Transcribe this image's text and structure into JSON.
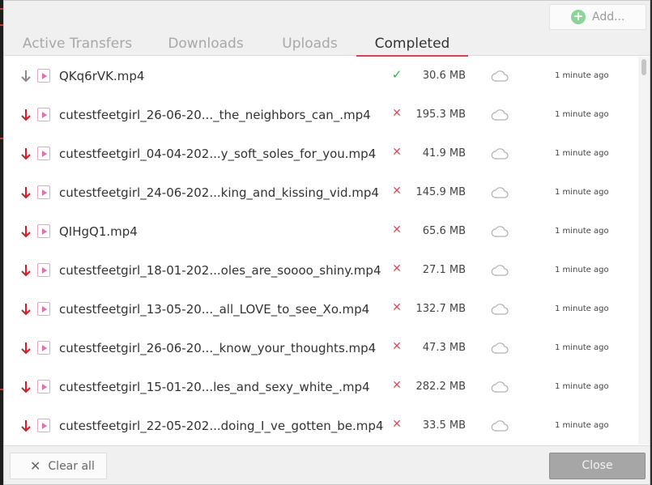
{
  "header": {
    "add_label": "Add...",
    "tabs": [
      {
        "label": "Active Transfers",
        "active": false
      },
      {
        "label": "Downloads",
        "active": false
      },
      {
        "label": "Uploads",
        "active": false
      },
      {
        "label": "Completed",
        "active": true
      }
    ]
  },
  "transfers": [
    {
      "name": "QKq6rVK.mp4",
      "status": "ok",
      "size": "30.6 MB",
      "time": "1 minute ago"
    },
    {
      "name": "cutestfeetgirl_26-06-20..._the_neighbors_can_.mp4",
      "status": "error",
      "size": "195.3 MB",
      "time": "1 minute ago"
    },
    {
      "name": "cutestfeetgirl_04-04-202...y_soft_soles_for_you.mp4",
      "status": "error",
      "size": "41.9 MB",
      "time": "1 minute ago"
    },
    {
      "name": "cutestfeetgirl_24-06-202...king_and_kissing_vid.mp4",
      "status": "error",
      "size": "145.9 MB",
      "time": "1 minute ago"
    },
    {
      "name": "QIHgQ1.mp4",
      "status": "error",
      "size": "65.6 MB",
      "time": "1 minute ago"
    },
    {
      "name": "cutestfeetgirl_18-01-202...oles_are_soooo_shiny.mp4",
      "status": "error",
      "size": "27.1 MB",
      "time": "1 minute ago"
    },
    {
      "name": "cutestfeetgirl_13-05-20..._all_LOVE_to_see_Xo.mp4",
      "status": "error",
      "size": "132.7 MB",
      "time": "1 minute ago"
    },
    {
      "name": "cutestfeetgirl_26-06-20..._know_your_thoughts.mp4",
      "status": "error",
      "size": "47.3 MB",
      "time": "1 minute ago"
    },
    {
      "name": "cutestfeetgirl_15-01-20...les_and_sexy_white_.mp4",
      "status": "error",
      "size": "282.2 MB",
      "time": "1 minute ago"
    },
    {
      "name": "cutestfeetgirl_22-05-202...doing_I_ve_gotten_be.mp4",
      "status": "error",
      "size": "33.5 MB",
      "time": "1 minute ago"
    }
  ],
  "footer": {
    "clear_label": "Clear all",
    "close_label": "Close"
  },
  "colors": {
    "accent": "#d04455",
    "ok": "#2fae4a",
    "error": "#de4b5b",
    "arrow_error": "#d81b2b",
    "arrow_ok": "#8a8a8a"
  },
  "icons": {
    "add": "plus-circle-icon",
    "status_ok": "check-icon",
    "status_error": "x-icon",
    "direction": "download-arrow-icon",
    "file": "video-file-icon",
    "sync": "cloud-icon",
    "clear": "x-icon"
  }
}
